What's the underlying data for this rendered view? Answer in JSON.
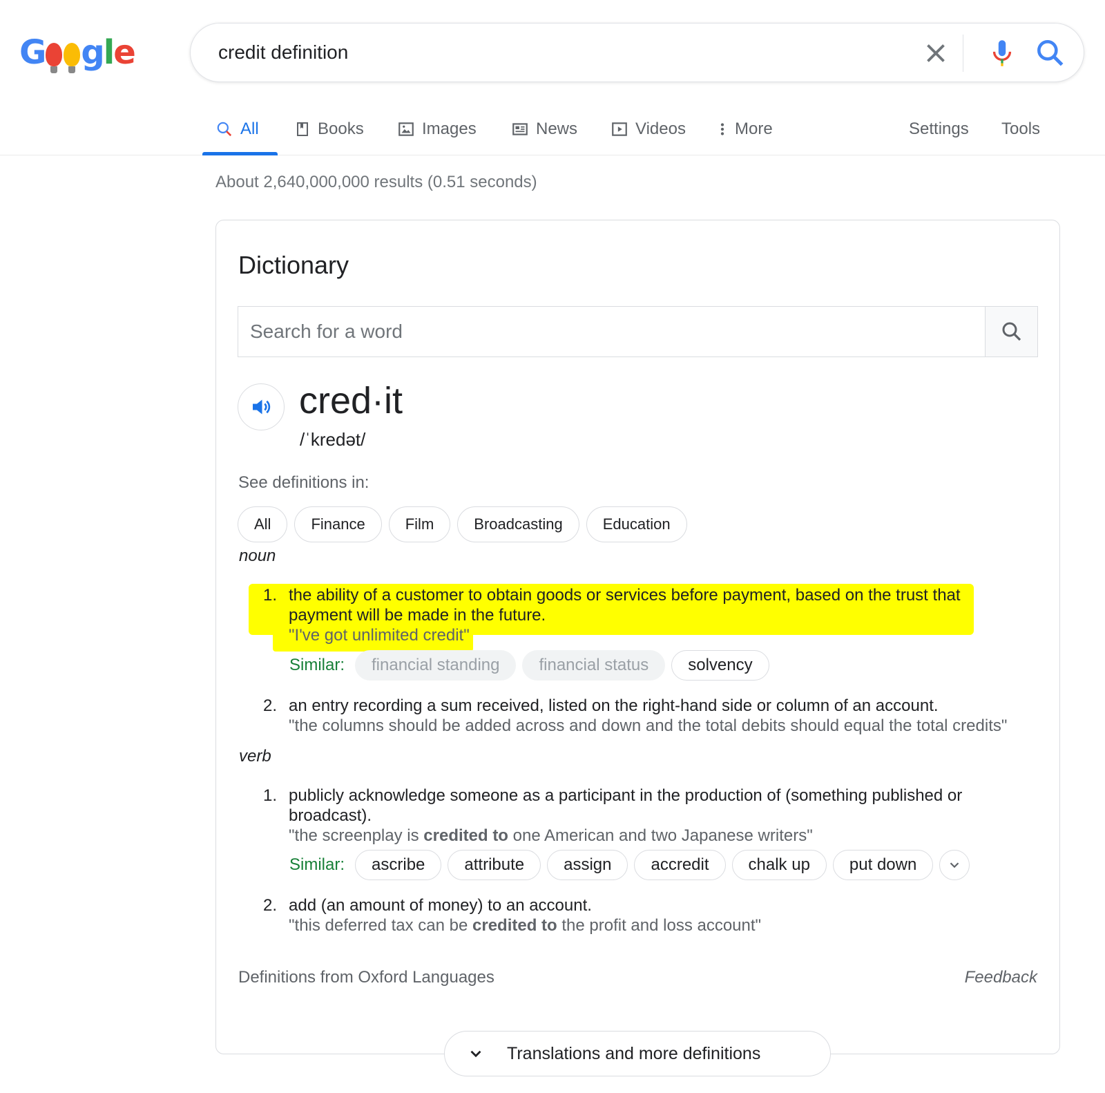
{
  "search": {
    "query": "credit definition"
  },
  "tabs": [
    {
      "label": "All",
      "icon": "search-icon"
    },
    {
      "label": "Books",
      "icon": "book-icon"
    },
    {
      "label": "Images",
      "icon": "image-icon"
    },
    {
      "label": "News",
      "icon": "news-icon"
    },
    {
      "label": "Videos",
      "icon": "video-icon"
    },
    {
      "label": "More",
      "icon": "more-vert-icon"
    }
  ],
  "tools": {
    "settings": "Settings",
    "tools": "Tools"
  },
  "result_stats": "About 2,640,000,000 results (0.51 seconds)",
  "dictionary": {
    "title": "Dictionary",
    "search_placeholder": "Search for a word",
    "headword": "cred·it",
    "phonetic": "/ˈkredət/",
    "see_definitions_label": "See definitions in:",
    "categories": [
      "All",
      "Finance",
      "Film",
      "Broadcasting",
      "Education"
    ],
    "noun": {
      "pos": "noun",
      "senses": [
        {
          "num": "1.",
          "definition": "the ability of a customer to obtain goods or services before payment, based on the trust that payment will be made in the future.",
          "example": "\"I've got unlimited credit\"",
          "similar_label": "Similar:",
          "similar": [
            "financial standing",
            "financial status",
            "solvency"
          ]
        },
        {
          "num": "2.",
          "definition": "an entry recording a sum received, listed on the right-hand side or column of an account.",
          "example": "\"the columns should be added across and down and the total debits should equal the total credits\""
        }
      ]
    },
    "verb": {
      "pos": "verb",
      "senses": [
        {
          "num": "1.",
          "definition": "publicly acknowledge someone as a participant in the production of (something published or broadcast).",
          "example_pre": "\"the screenplay is ",
          "example_bold": "credited to",
          "example_post": " one American and two Japanese writers\"",
          "similar_label": "Similar:",
          "similar": [
            "ascribe",
            "attribute",
            "assign",
            "accredit",
            "chalk up",
            "put down"
          ]
        },
        {
          "num": "2.",
          "definition": "add (an amount of money) to an account.",
          "example_pre": "\"this deferred tax can be ",
          "example_bold": "credited to",
          "example_post": " the profit and loss account\""
        }
      ]
    },
    "source": "Definitions from Oxford Languages",
    "feedback": "Feedback"
  },
  "more_definitions": "Translations and more definitions",
  "colors": {
    "accent": "#1a73e8",
    "highlight": "#ffff00",
    "similar": "#188038"
  }
}
